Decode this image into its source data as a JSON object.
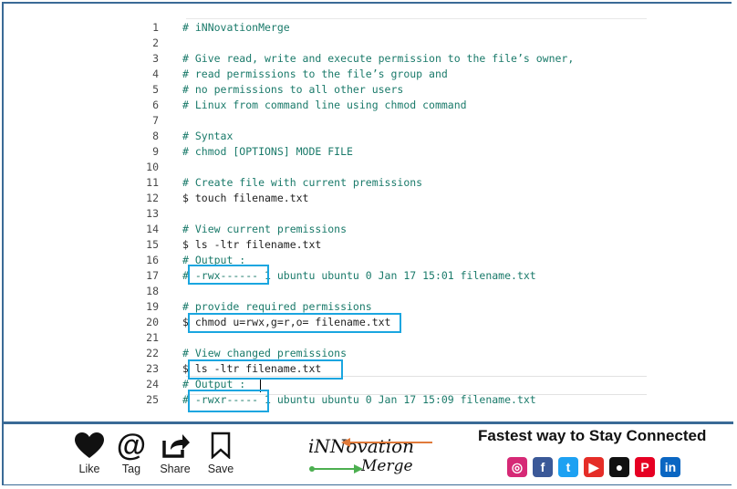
{
  "editor": {
    "lines": [
      {
        "n": "1",
        "text": "# iNNovationMerge",
        "kind": "comment"
      },
      {
        "n": "2",
        "text": "",
        "kind": "comment"
      },
      {
        "n": "3",
        "text": "# Give read, write and execute permission to the file’s owner,",
        "kind": "comment"
      },
      {
        "n": "4",
        "text": "# read permissions to the file’s group and",
        "kind": "comment"
      },
      {
        "n": "5",
        "text": "# no permissions to all other users",
        "kind": "comment"
      },
      {
        "n": "6",
        "text": "# Linux from command line using chmod command",
        "kind": "comment"
      },
      {
        "n": "7",
        "text": "",
        "kind": "comment"
      },
      {
        "n": "8",
        "text": "# Syntax",
        "kind": "comment"
      },
      {
        "n": "9",
        "text": "# chmod [OPTIONS] MODE FILE",
        "kind": "comment"
      },
      {
        "n": "10",
        "text": "",
        "kind": "comment"
      },
      {
        "n": "11",
        "text": "# Create file with current premissions",
        "kind": "comment"
      },
      {
        "n": "12",
        "text": "$ touch filename.txt",
        "kind": "cmd"
      },
      {
        "n": "13",
        "text": "",
        "kind": "comment"
      },
      {
        "n": "14",
        "text": "# View current premissions",
        "kind": "comment"
      },
      {
        "n": "15",
        "text": "$ ls -ltr filename.txt",
        "kind": "cmd"
      },
      {
        "n": "16",
        "text": "# Output :",
        "kind": "comment"
      },
      {
        "n": "17",
        "text": "# -rwx------ 1 ubuntu ubuntu 0 Jan 17 15:01 filename.txt",
        "kind": "comment"
      },
      {
        "n": "18",
        "text": "",
        "kind": "comment"
      },
      {
        "n": "19",
        "text": "# provide required permissions",
        "kind": "comment"
      },
      {
        "n": "20",
        "text": "$ chmod u=rwx,g=r,o= filename.txt",
        "kind": "cmd"
      },
      {
        "n": "21",
        "text": "",
        "kind": "comment"
      },
      {
        "n": "22",
        "text": "# View changed premissions",
        "kind": "comment"
      },
      {
        "n": "23",
        "text": "$ ls -ltr filename.txt",
        "kind": "cmd"
      },
      {
        "n": "24",
        "text": "# Output :",
        "kind": "comment"
      },
      {
        "n": "25",
        "text": "# -rwxr----- 1 ubuntu ubuntu 0 Jan 17 15:09 filename.txt",
        "kind": "comment"
      }
    ]
  },
  "footer": {
    "like_label": "Like",
    "tag_label": "Tag",
    "share_label": "Share",
    "save_label": "Save",
    "brand_top": "iNNovation",
    "brand_bottom": "Merge",
    "tagline": "Fastest way to Stay Connected",
    "social": [
      {
        "name": "instagram-icon",
        "glyph": "◎",
        "color": "#d62976"
      },
      {
        "name": "facebook-icon",
        "glyph": "f",
        "color": "#3b5998"
      },
      {
        "name": "twitter-icon",
        "glyph": "t",
        "color": "#1da1f2"
      },
      {
        "name": "youtube-icon",
        "glyph": "▶",
        "color": "#e52d27"
      },
      {
        "name": "github-icon",
        "glyph": "●",
        "color": "#111111"
      },
      {
        "name": "pinterest-icon",
        "glyph": "P",
        "color": "#e60023"
      },
      {
        "name": "linkedin-icon",
        "glyph": "in",
        "color": "#0a66c2"
      }
    ]
  }
}
